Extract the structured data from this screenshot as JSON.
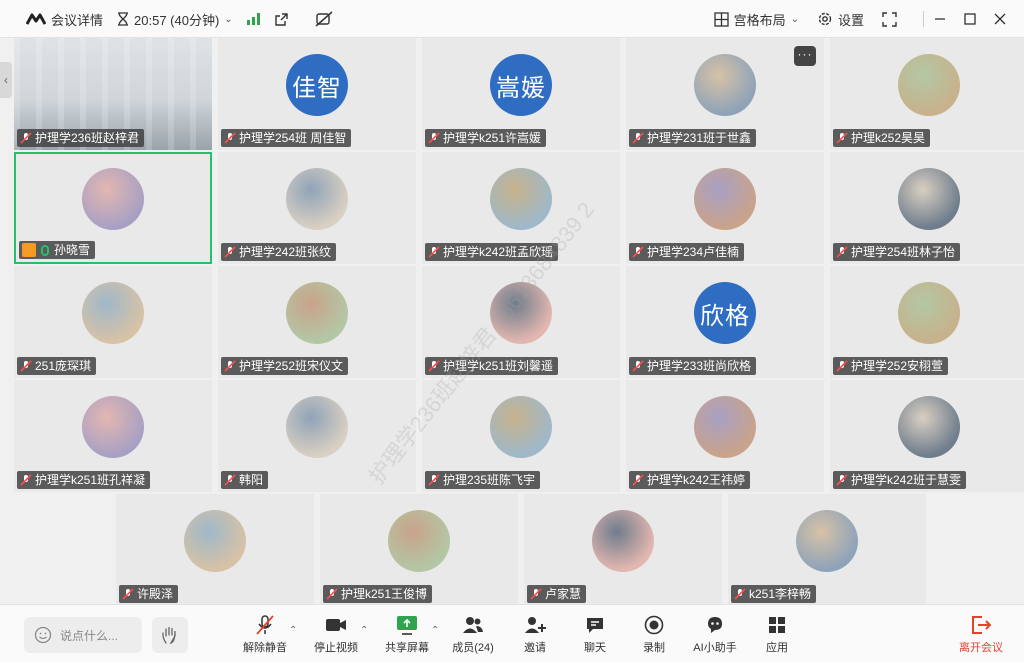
{
  "topbar": {
    "meeting_details": "会议详情",
    "time": "20:57 (40分钟)",
    "layout": "宫格布局",
    "settings": "设置"
  },
  "participants": [
    {
      "name": "护理学236班赵梓君",
      "avatar_type": "photo",
      "avatar_icon": "office-photo"
    },
    {
      "name": "护理学254班 周佳智",
      "avatar_type": "text",
      "avatar_text": "佳智"
    },
    {
      "name": "护理学k251许嵩媛",
      "avatar_type": "text",
      "avatar_text": "嵩媛"
    },
    {
      "name": "护理学231班于世鑫",
      "avatar_type": "photo",
      "avatar_icon": "hooded-figure"
    },
    {
      "name": "护理k252昊昊",
      "avatar_type": "photo",
      "avatar_icon": "anime-girl"
    },
    {
      "name": "孙晓雪",
      "avatar_type": "photo",
      "avatar_icon": "seaside-photo",
      "active": true
    },
    {
      "name": "护理学242班张纹",
      "avatar_type": "photo",
      "avatar_icon": "cat-with-rose"
    },
    {
      "name": "护理学k242班孟欣瑶",
      "avatar_type": "photo",
      "avatar_icon": "girl-glasses"
    },
    {
      "name": "护理学234卢佳楠",
      "avatar_type": "photo",
      "avatar_icon": "pink-pig"
    },
    {
      "name": "护理学254班林子怡",
      "avatar_type": "photo",
      "avatar_icon": "sketch"
    },
    {
      "name": "251庞琛琪",
      "avatar_type": "photo",
      "avatar_icon": "plush-toy"
    },
    {
      "name": "护理学252班宋仪文",
      "avatar_type": "photo",
      "avatar_icon": "girl-photo"
    },
    {
      "name": "护理学k251班刘馨遥",
      "avatar_type": "photo",
      "avatar_icon": "dog-photo"
    },
    {
      "name": "护理学233班尚欣格",
      "avatar_type": "text",
      "avatar_text": "欣格"
    },
    {
      "name": "护理学252安栩萱",
      "avatar_type": "photo",
      "avatar_icon": "bear-sketch"
    },
    {
      "name": "护理学k251班孔祥凝",
      "avatar_type": "photo",
      "avatar_icon": "cartoon-girl"
    },
    {
      "name": "韩阳",
      "avatar_type": "photo",
      "avatar_icon": "red-dragon"
    },
    {
      "name": "护理235班陈飞宇",
      "avatar_type": "photo",
      "avatar_icon": "black-cat"
    },
    {
      "name": "护理学k242王祎婷",
      "avatar_type": "photo",
      "avatar_icon": "anime-eyes"
    },
    {
      "name": "护理学k242班于慧雯",
      "avatar_type": "photo",
      "avatar_icon": "cartoon-character"
    },
    {
      "name": "许殿泽",
      "avatar_type": "photo",
      "avatar_icon": "girl-beanie"
    },
    {
      "name": "护理k251王俊博",
      "avatar_type": "photo",
      "avatar_icon": "girl-selfie"
    },
    {
      "name": "卢家慧",
      "avatar_type": "photo",
      "avatar_icon": "chibi-girl"
    },
    {
      "name": "k251李梓畅",
      "avatar_type": "photo",
      "avatar_icon": "baby-photo"
    }
  ],
  "watermark": "护理学236班赵梓君 18613684839 2",
  "toolbar": {
    "chat_placeholder": "说点什么...",
    "unmute": "解除静音",
    "stop_video": "停止视频",
    "share_screen": "共享屏幕",
    "members": "成员(24)",
    "invite": "邀请",
    "chat": "聊天",
    "record": "录制",
    "ai_assistant": "AI小助手",
    "apps": "应用",
    "leave": "离开会议"
  },
  "colors": {
    "accent_green": "#25c06d",
    "text_avatar_blue": "#2f6dc2",
    "leave_red": "#e8412c",
    "share_green": "#2ea44f"
  }
}
